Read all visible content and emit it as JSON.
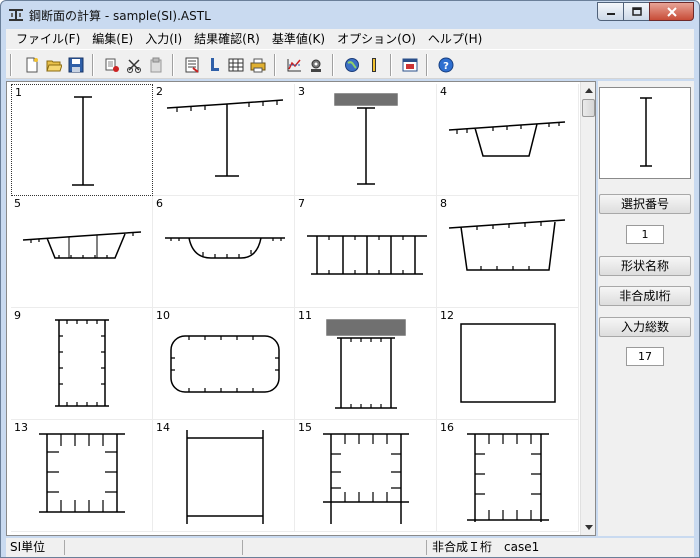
{
  "window": {
    "title": "鋼断面の計算 - sample(SI).ASTL"
  },
  "menu": [
    "ファイル(F)",
    "編集(E)",
    "入力(I)",
    "結果確認(R)",
    "基準値(K)",
    "オプション(O)",
    "ヘルプ(H)"
  ],
  "toolbar": {
    "buttons": [
      "new-file-icon",
      "open-folder-icon",
      "save-disk-icon",
      "cut-icon",
      "copy-icon",
      "paste-icon",
      "calculator-icon",
      "section-shape-icon",
      "table-icon",
      "printer-icon",
      "graph-icon",
      "settings-icon",
      "globe-icon",
      "bar-icon",
      "window-icon",
      "help-icon"
    ]
  },
  "grid": {
    "cells": [
      {
        "number": "1"
      },
      {
        "number": "2"
      },
      {
        "number": "3"
      },
      {
        "number": "4"
      },
      {
        "number": "5"
      },
      {
        "number": "6"
      },
      {
        "number": "7"
      },
      {
        "number": "8"
      },
      {
        "number": "9"
      },
      {
        "number": "10"
      },
      {
        "number": "11"
      },
      {
        "number": "12"
      },
      {
        "number": "13"
      },
      {
        "number": "14"
      },
      {
        "number": "15"
      },
      {
        "number": "16"
      }
    ],
    "selected": "1"
  },
  "side_panel": {
    "selection_label": "選択番号",
    "selection_value": "1",
    "shape_name_label": "形状名称",
    "non_composite_label": "非合成I桁",
    "total_label": "入力総数",
    "total_value": "17"
  },
  "status": {
    "units": "SI単位",
    "mode": "非合成Ｉ桁",
    "case": "case1"
  }
}
